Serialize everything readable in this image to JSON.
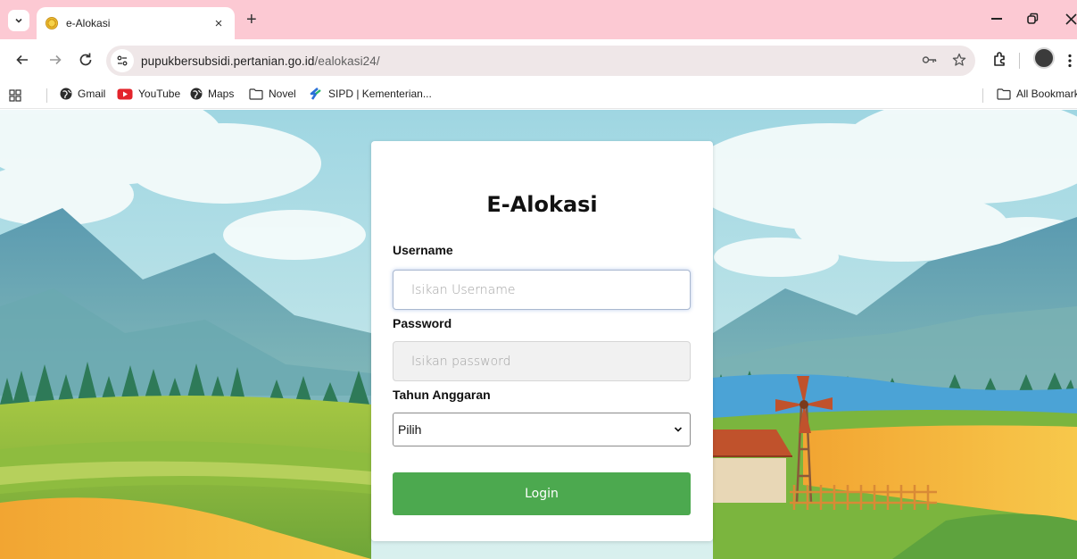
{
  "browser": {
    "tab": {
      "title": "e-Alokasi",
      "close_glyph": "×"
    },
    "new_tab_glyph": "+",
    "url": {
      "host": "pupukbersubsidi.pertanian.go.id",
      "path": "/ealokasi24/"
    },
    "bookmarks": [
      {
        "label": "Gmail",
        "icon": "globe-icon"
      },
      {
        "label": "YouTube",
        "icon": "youtube-icon"
      },
      {
        "label": "Maps",
        "icon": "globe-icon"
      },
      {
        "label": "Novel",
        "icon": "folder-icon"
      },
      {
        "label": "SIPD | Kementerian...",
        "icon": "sipd-icon"
      }
    ],
    "all_bookmarks": "All Bookmark"
  },
  "login": {
    "title": "E-Alokasi",
    "username_label": "Username",
    "username_placeholder": "Isikan Username",
    "password_label": "Password",
    "password_placeholder": "Isikan password",
    "year_label": "Tahun Anggaran",
    "year_selected": "Pilih",
    "button": "Login"
  },
  "colors": {
    "tabstrip": "#fcc9d3",
    "login_button": "#4ca94f",
    "sky": "#bfe3ea"
  }
}
